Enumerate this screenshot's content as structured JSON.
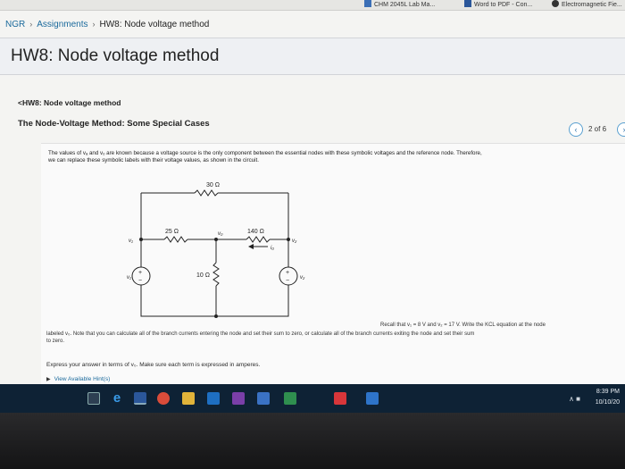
{
  "top_strip": {
    "items": [
      {
        "label": "CHM 2045L Lab Ma...",
        "icon": "document-icon",
        "color": "#3b6fb6"
      },
      {
        "label": "Word to PDF - Con...",
        "icon": "word-icon",
        "color": "#2b579a"
      },
      {
        "label": "Electromagnetic Fie...",
        "icon": "chrome-icon",
        "color": "#333333"
      }
    ]
  },
  "breadcrumb": {
    "root": "NGR",
    "assignments": "Assignments",
    "current": "HW8: Node voltage method"
  },
  "header": {
    "title": "HW8: Node voltage method"
  },
  "problem": {
    "back_link": "<HW8: Node voltage method",
    "section_title": "The Node-Voltage Method: Some Special Cases",
    "pager_text": "2 of 6",
    "prev_icon": "chevron-left-icon",
    "next_icon": "chevron-right-icon",
    "intro_line1": "The values of vₐ and vₒ are known because a voltage source is the only component between the essential nodes with these symbolic voltages and the reference node. Therefore,",
    "intro_line2": "we can replace these symbolic labels with their voltage values, as shown in the circuit.",
    "recall": "Recall that v₁ = 8 V and v₂ = 17 V. Write the KCL equation at the node",
    "kcl_line1": "labeled v₀. Note that you can calculate all of the branch currents entering the node and set their sum to zero, or calculate all of the branch currents exiting the node and set their sum",
    "kcl_line2": "to zero.",
    "express": "Express your answer in terms of v₀. Make sure each term is expressed in amperes.",
    "hints": "View Available Hint(s)"
  },
  "circuit": {
    "r_top": "30 Ω",
    "r_left": "25 Ω",
    "r_right": "140 Ω",
    "r_mid": "10 Ω",
    "v1": "v₁",
    "v2": "v₂",
    "v0": "v₀",
    "i0": "i₀",
    "src_left_label": "v₁",
    "src_right_label": "v₂",
    "plus": "+",
    "minus": "−"
  },
  "taskbar": {
    "time": "8:39 PM",
    "date": "10/10/20",
    "icons": [
      "start-icon",
      "task-view-icon",
      "edge-icon",
      "word-icon",
      "chrome-icon",
      "file-explorer-icon",
      "onenote-icon",
      "store-icon",
      "onedrive-icon",
      "unknown-icon",
      "acrobat-icon",
      "media-icon"
    ]
  }
}
